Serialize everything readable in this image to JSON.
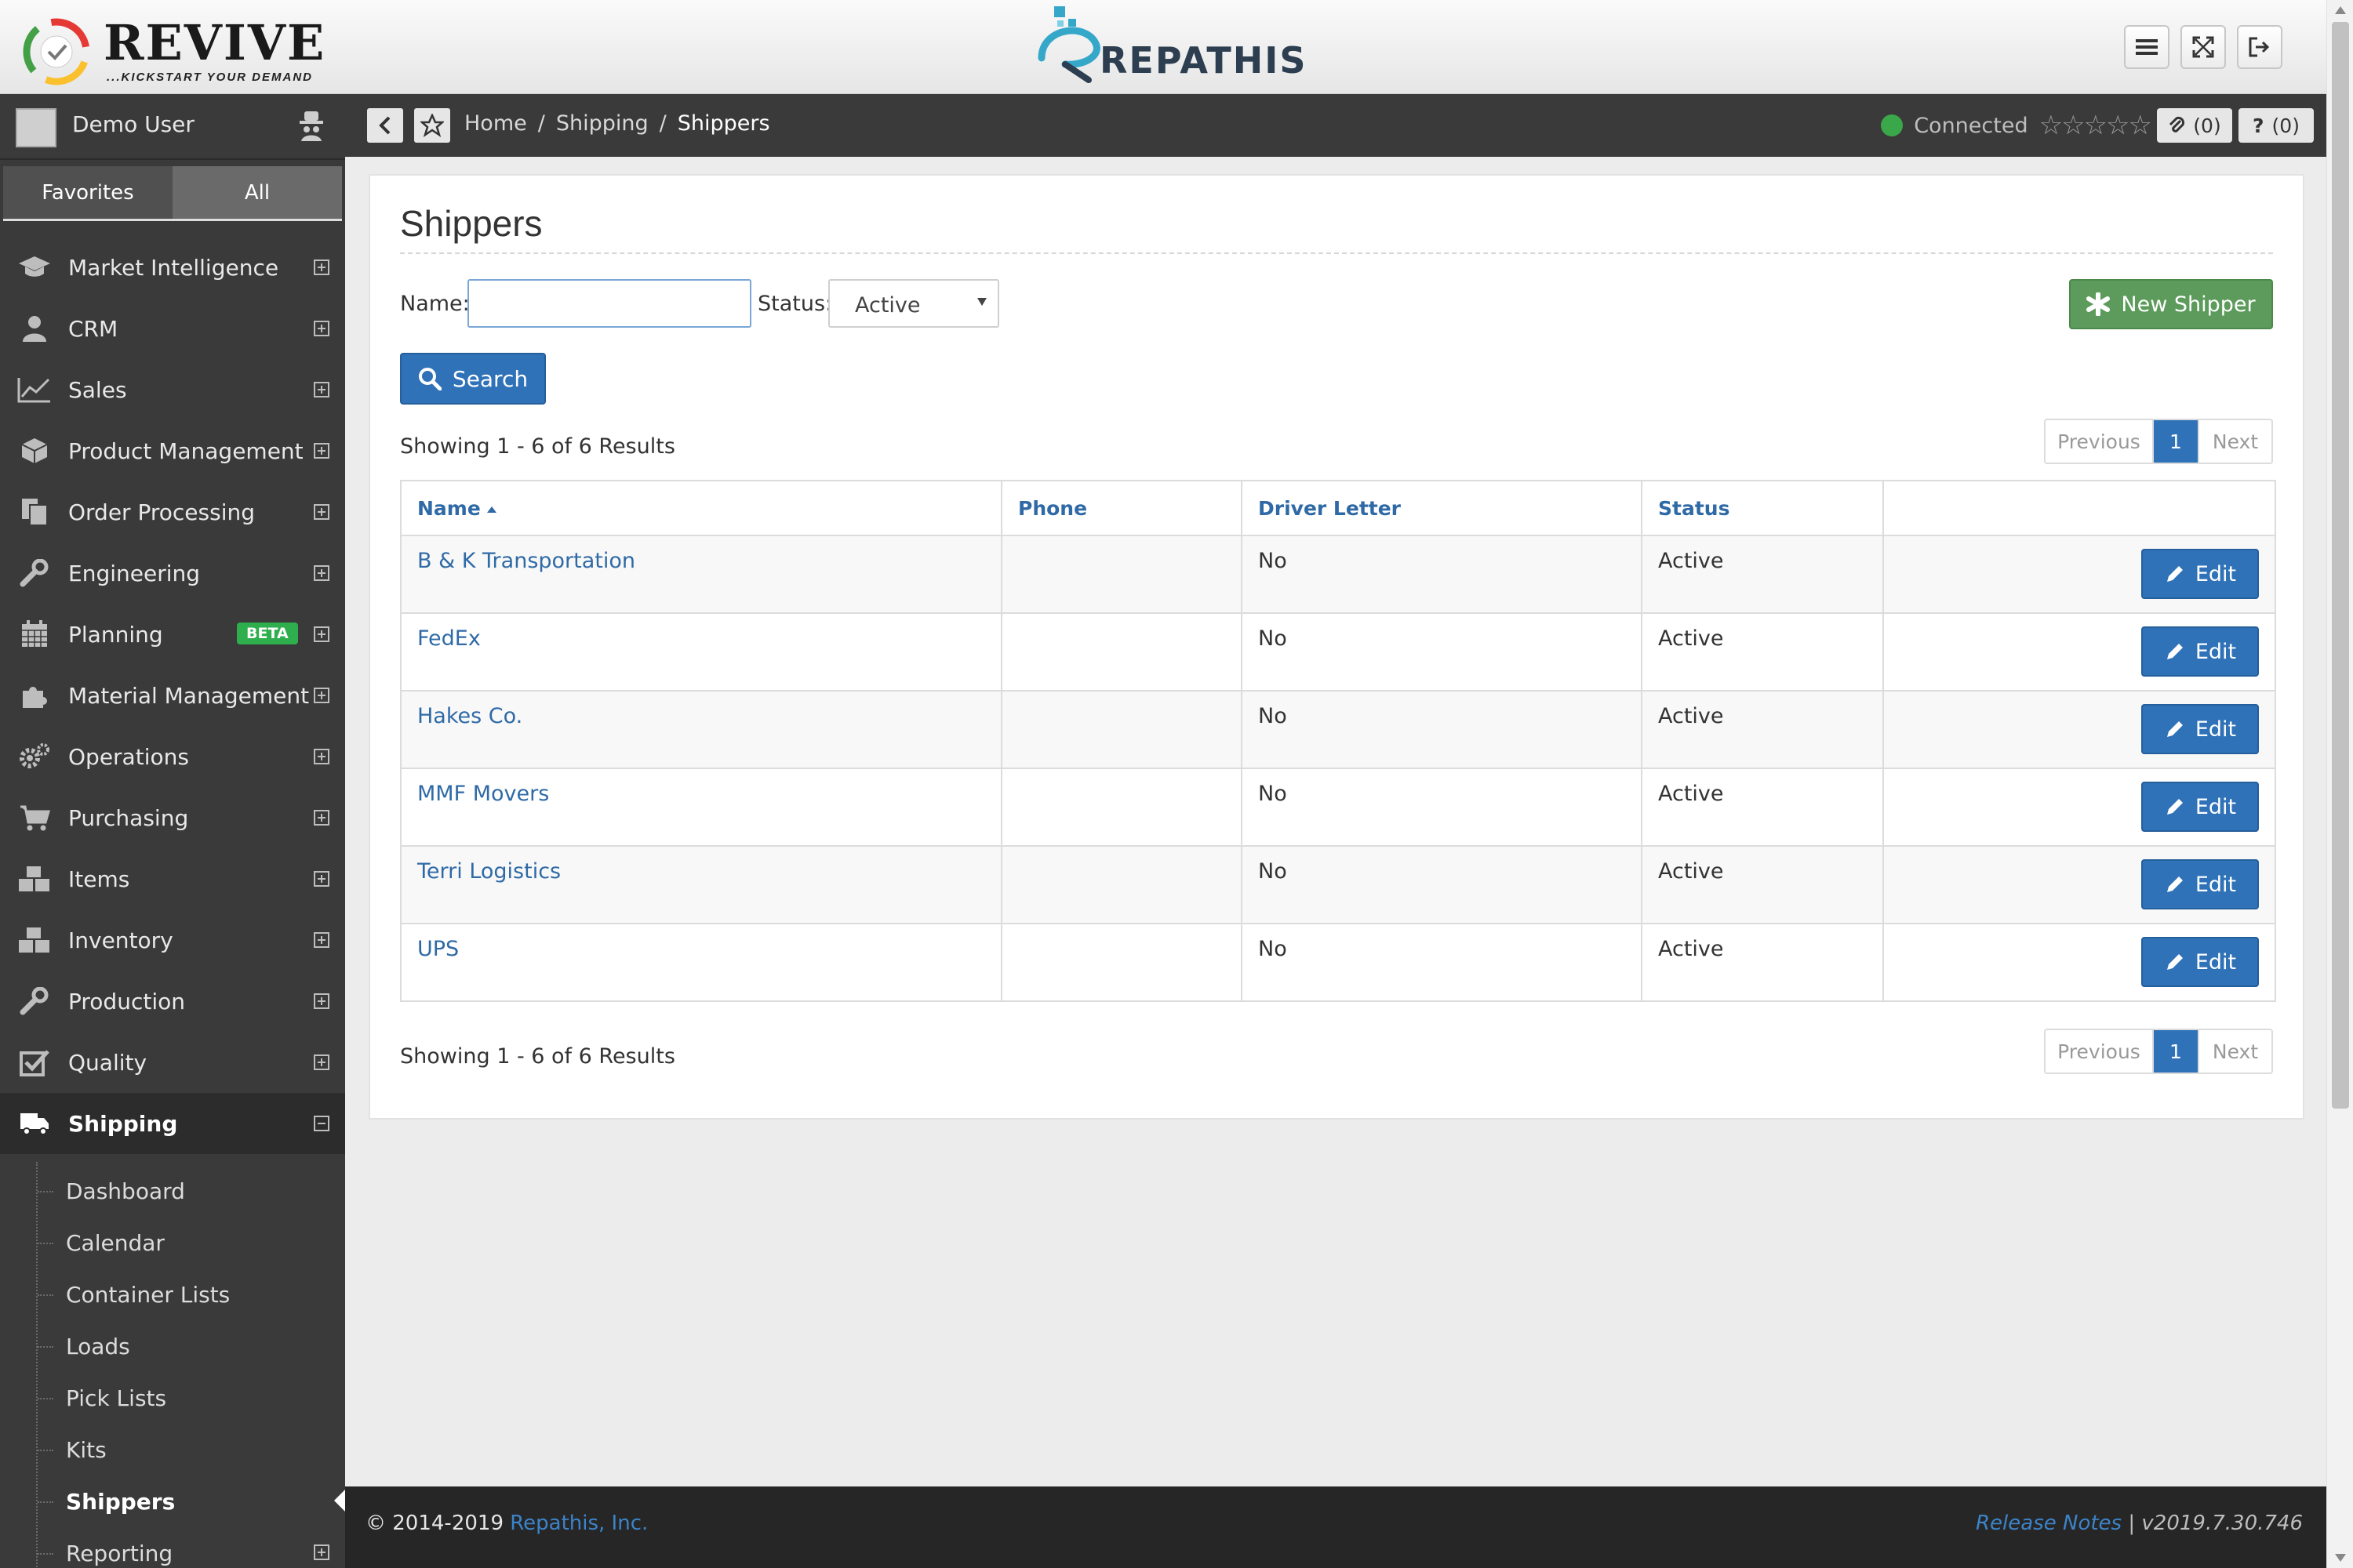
{
  "header": {
    "brand_name": "REVIVE",
    "brand_tagline": "...KICKSTART YOUR DEMAND",
    "center_logo_text": "REPATHIS"
  },
  "user": {
    "name": "Demo User"
  },
  "sidebar": {
    "tabs": [
      {
        "label": "Favorites"
      },
      {
        "label": "All"
      }
    ],
    "items": [
      {
        "label": "Market Intelligence",
        "icon": "graduation-cap-icon"
      },
      {
        "label": "CRM",
        "icon": "user-icon"
      },
      {
        "label": "Sales",
        "icon": "line-chart-icon"
      },
      {
        "label": "Product Management",
        "icon": "cube-icon"
      },
      {
        "label": "Order Processing",
        "icon": "documents-icon"
      },
      {
        "label": "Engineering",
        "icon": "wrench-icon"
      },
      {
        "label": "Planning",
        "icon": "calendar-icon",
        "badge": "BETA"
      },
      {
        "label": "Material Management",
        "icon": "puzzle-icon"
      },
      {
        "label": "Operations",
        "icon": "gears-icon"
      },
      {
        "label": "Purchasing",
        "icon": "cart-icon"
      },
      {
        "label": "Items",
        "icon": "cubes-icon"
      },
      {
        "label": "Inventory",
        "icon": "cubes-icon"
      },
      {
        "label": "Production",
        "icon": "wrench-icon"
      },
      {
        "label": "Quality",
        "icon": "checkbox-icon"
      },
      {
        "label": "Shipping",
        "icon": "truck-icon"
      }
    ],
    "shipping_sub": [
      {
        "label": "Dashboard"
      },
      {
        "label": "Calendar"
      },
      {
        "label": "Container Lists"
      },
      {
        "label": "Loads"
      },
      {
        "label": "Pick Lists"
      },
      {
        "label": "Kits"
      },
      {
        "label": "Shippers"
      },
      {
        "label": "Reporting"
      }
    ]
  },
  "breadcrumb": {
    "items": [
      "Home",
      "Shipping",
      "Shippers"
    ],
    "separator": "/",
    "status": "Connected",
    "stars": "☆☆☆☆☆",
    "attachments": "(0)",
    "help": "(0)"
  },
  "page": {
    "title": "Shippers",
    "name_label": "Name:",
    "name_value": "",
    "status_label": "Status:",
    "status_value": "Active",
    "new_button": "New Shipper",
    "search_button": "Search",
    "showing": "Showing 1 - 6 of 6 Results",
    "pager": {
      "prev": "Previous",
      "page": "1",
      "next": "Next"
    }
  },
  "table": {
    "headers": [
      "Name",
      "Phone",
      "Driver Letter",
      "Status",
      ""
    ],
    "edit_label": "Edit",
    "rows": [
      {
        "name": "B & K Transportation",
        "phone": "",
        "driver_letter": "No",
        "status": "Active"
      },
      {
        "name": "FedEx",
        "phone": "",
        "driver_letter": "No",
        "status": "Active"
      },
      {
        "name": "Hakes Co.",
        "phone": "",
        "driver_letter": "No",
        "status": "Active"
      },
      {
        "name": "MMF Movers",
        "phone": "",
        "driver_letter": "No",
        "status": "Active"
      },
      {
        "name": "Terri Logistics",
        "phone": "",
        "driver_letter": "No",
        "status": "Active"
      },
      {
        "name": "UPS",
        "phone": "",
        "driver_letter": "No",
        "status": "Active"
      }
    ]
  },
  "footer": {
    "copyright": "© 2014-2019",
    "company": "Repathis, Inc.",
    "release_notes": "Release Notes",
    "version": " | v2019.7.30.746"
  },
  "colors": {
    "sidebar_bg": "#3a3a3a",
    "primary": "#2f72b8",
    "success": "#5c9b5b",
    "link": "#2f6aa6",
    "connected": "#3aa84a",
    "beta": "#2fae4e"
  }
}
